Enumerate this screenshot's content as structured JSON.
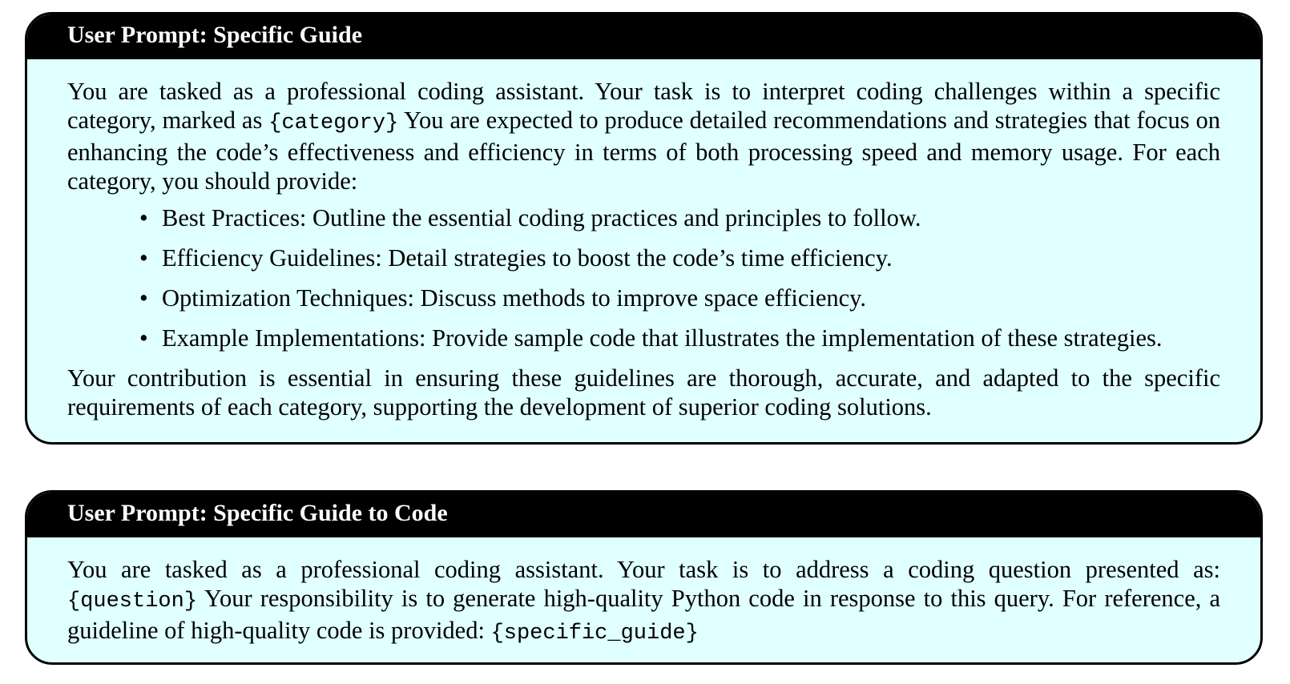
{
  "box1": {
    "title": "User Prompt: Specific Guide",
    "intro_pre": "You are tasked as a professional coding assistant. Your task is to interpret coding challenges within a specific category, marked as ",
    "intro_code": "{category}",
    "intro_post": " You are expected to produce detailed recommendations and strategies that focus on enhancing the code’s effectiveness and efficiency in terms of both processing speed and memory usage. For each category, you should provide:",
    "bullet_glyph": "•",
    "items": [
      "Best Practices: Outline the essential coding practices and principles to follow.",
      "Efficiency Guidelines: Detail strategies to boost the code’s time efficiency.",
      "Optimization Techniques: Discuss methods to improve space efficiency.",
      "Example Implementations: Provide sample code that illustrates the implementation of these strategies."
    ],
    "closing": "Your contribution is essential in ensuring these guidelines are thorough, accurate, and adapted to the specific requirements of each category, supporting the development of superior coding solutions."
  },
  "box2": {
    "title": "User Prompt: Specific Guide to Code",
    "text_pre": "You are tasked as a professional coding assistant. Your task is to address a coding question presented as: ",
    "code_question": "{question}",
    "text_mid": " Your responsibility is to generate high-quality Python code in response to this query. For reference, a guideline of high-quality code is provided: ",
    "code_guide": "{specific_guide}"
  },
  "colors": {
    "header_bg": "#000000",
    "header_text": "#ffffff",
    "body_bg": "#e0ffff",
    "border": "#000000"
  }
}
